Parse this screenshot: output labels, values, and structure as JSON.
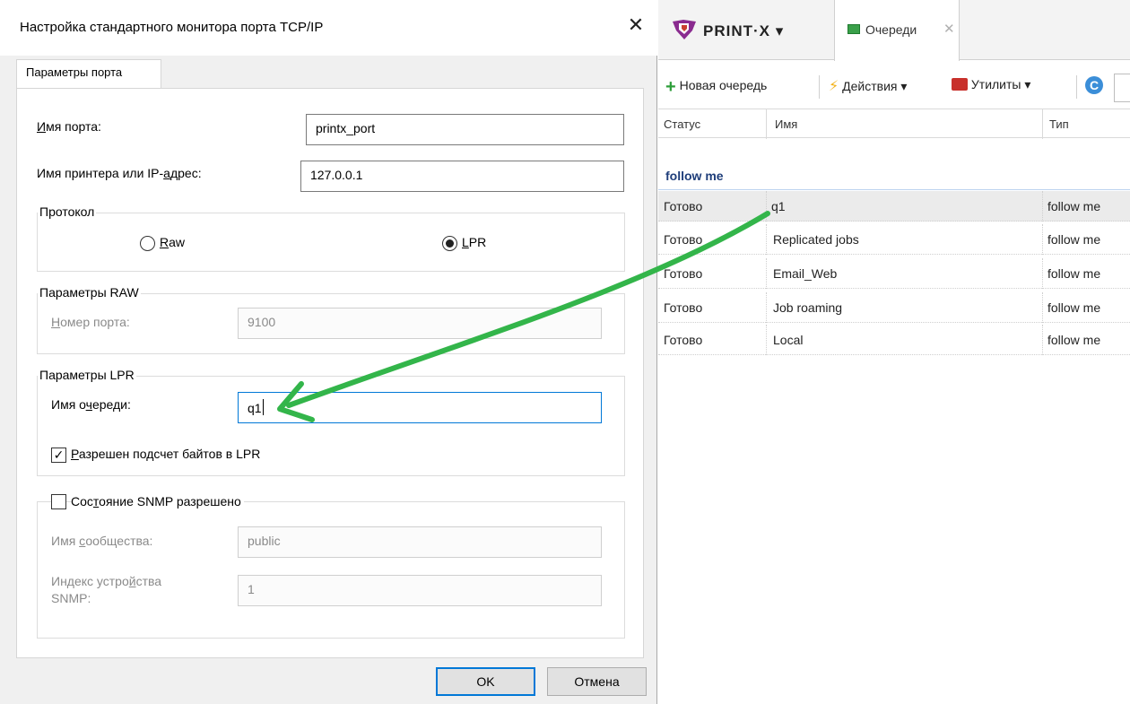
{
  "dialog": {
    "title": "Настройка стандартного монитора порта TCP/IP",
    "close_glyph": "✕",
    "tab_label": "Параметры порта",
    "port_name": {
      "label_u": "И",
      "label_rest": "мя порта:",
      "value": "printx_port"
    },
    "printer_address": {
      "label_pre": "Имя принтера или IP-",
      "label_u": "а",
      "label_rest": "дрес:",
      "value": "127.0.0.1"
    },
    "protocol": {
      "legend": "Протокол",
      "raw": {
        "u": "R",
        "rest": "aw",
        "selected": false
      },
      "lpr": {
        "u": "L",
        "rest": "PR",
        "selected": true
      }
    },
    "raw_settings": {
      "legend": "Параметры RAW",
      "port_number": {
        "label_u": "Н",
        "label_rest": "омер порта:",
        "value": "9100"
      }
    },
    "lpr_settings": {
      "legend": "Параметры LPR",
      "queue_name": {
        "label_pre": "Имя о",
        "label_u": "ч",
        "label_rest": "ереди:",
        "value": "q1"
      },
      "byte_counting": {
        "u": "Р",
        "rest": "азрешен подсчет байтов в LPR",
        "checked": true
      }
    },
    "snmp": {
      "enabled": {
        "pre": "Сос",
        "u": "т",
        "rest": "ояние SNMP разрешено",
        "checked": false
      },
      "community": {
        "label_pre": "Имя ",
        "label_u": "с",
        "label_rest": "ообщества:",
        "value": "public"
      },
      "device_index": {
        "label_line1_pre": "Индекс устро",
        "label_line1_u": "й",
        "label_line1_rest": "ства",
        "label_line2": "SNMP:",
        "value": "1"
      }
    },
    "ok_label": "OK",
    "cancel_label": "Отмена"
  },
  "app": {
    "logo_text": "PRINT·X ▾",
    "tab_label": "Очереди",
    "tab_close": "✕",
    "toolbar": {
      "new_queue": "Новая очередь",
      "actions": "Действия ▾",
      "utilities": "Утилиты ▾"
    },
    "columns": {
      "status": "Статус",
      "name": "Имя",
      "type": "Тип"
    },
    "group_label": "follow me",
    "rows": [
      {
        "status": "Готово",
        "name": "q1",
        "type": "follow me"
      },
      {
        "status": "Готово",
        "name": "Replicated jobs",
        "type": "follow me"
      },
      {
        "status": "Готово",
        "name": "Email_Web",
        "type": "follow me"
      },
      {
        "status": "Готово",
        "name": "Job roaming",
        "type": "follow me"
      },
      {
        "status": "Готово",
        "name": "Local",
        "type": "follow me"
      }
    ],
    "selected_row": 0,
    "colors": {
      "accent": "#0078d7",
      "annotation_arrow": "#33b54a",
      "group_text": "#1f3e7a"
    }
  }
}
